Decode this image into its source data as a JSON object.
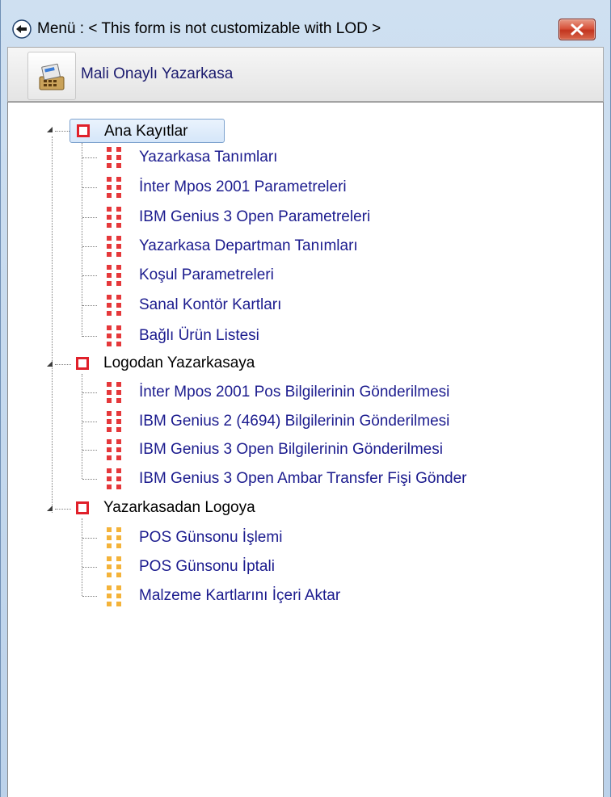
{
  "window": {
    "title": "Menü : < This form is not customizable with LOD >",
    "title_icon": "arrow-back-icon",
    "close_icon": "close-icon"
  },
  "header": {
    "app_icon": "cash-register-icon",
    "label": "Mali Onaylı Yazarkasa"
  },
  "colors": {
    "leaf_red": "#e5383b",
    "leaf_orange": "#f4b33a",
    "leaf_text": "#1b1b8e",
    "root_icon": "#e0202a",
    "selection": "#d5e6f9"
  },
  "tree": {
    "groups": [
      {
        "label": "Ana Kayıtlar",
        "expanded": true,
        "selected": true,
        "items": [
          "Yazarkasa Tanımları",
          "İnter Mpos 2001 Parametreleri",
          "IBM Genius 3 Open Parametreleri",
          "Yazarkasa Departman Tanımları",
          "Koşul Parametreleri",
          "Sanal Kontör Kartları",
          "Bağlı Ürün Listesi"
        ]
      },
      {
        "label": "Logodan Yazarkasaya",
        "expanded": true,
        "selected": false,
        "items": [
          "İnter Mpos 2001 Pos Bilgilerinin Gönderilmesi",
          "IBM Genius 2 (4694) Bilgilerinin Gönderilmesi",
          "IBM Genius 3 Open Bilgilerinin Gönderilmesi",
          "IBM Genius 3 Open Ambar Transfer Fişi Gönder"
        ]
      },
      {
        "label": "Yazarkasadan Logoya",
        "expanded": true,
        "selected": false,
        "items": [
          "POS Günsonu İşlemi",
          "POS Günsonu İptali",
          "Malzeme Kartlarını İçeri Aktar"
        ]
      }
    ]
  }
}
